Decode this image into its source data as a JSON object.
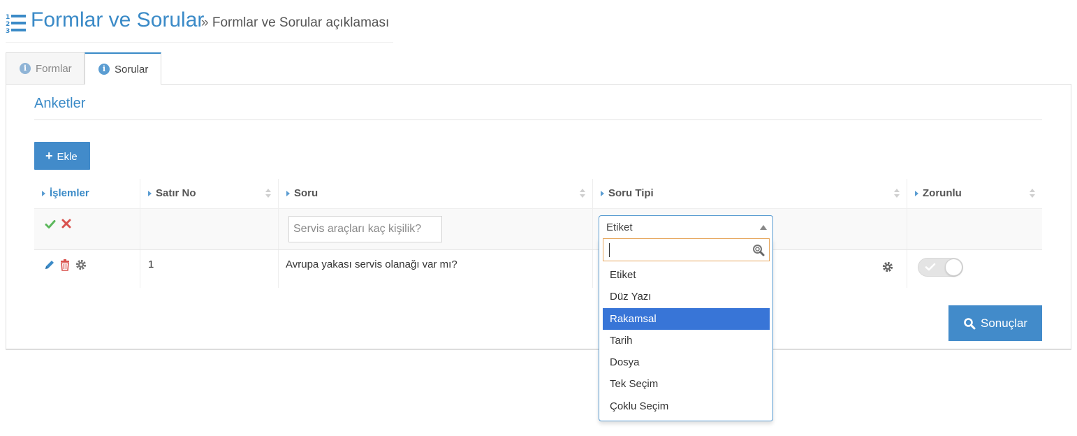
{
  "header": {
    "title": "Formlar ve Sorular",
    "separator": "»",
    "subtitle": "Formlar ve Sorular açıklaması"
  },
  "tabs": [
    {
      "label": "Formlar",
      "active": false
    },
    {
      "label": "Sorular",
      "active": true
    }
  ],
  "panel": {
    "title": "Anketler",
    "add_button": "Ekle",
    "results_button": "Sonuçlar"
  },
  "table": {
    "columns": [
      "İşlemler",
      "Satır No",
      "Soru",
      "Soru Tipi",
      "Zorunlu"
    ],
    "edit_row": {
      "question_placeholder": "Servis araçları kaç kişilik?",
      "type_value": "Etiket"
    },
    "rows": [
      {
        "no": "1",
        "question": "Avrupa yakası servis olanağı var mı?",
        "required": true
      }
    ]
  },
  "dropdown": {
    "search_value": "",
    "options": [
      "Etiket",
      "Düz Yazı",
      "Rakamsal",
      "Tarih",
      "Dosya",
      "Tek Seçim",
      "Çoklu Seçim"
    ],
    "highlighted_index": 2
  },
  "colors": {
    "accent": "#3a8ac7",
    "button": "#428bca",
    "highlight": "#3875d7",
    "ok": "#5cb85c",
    "cancel": "#d9534f"
  }
}
